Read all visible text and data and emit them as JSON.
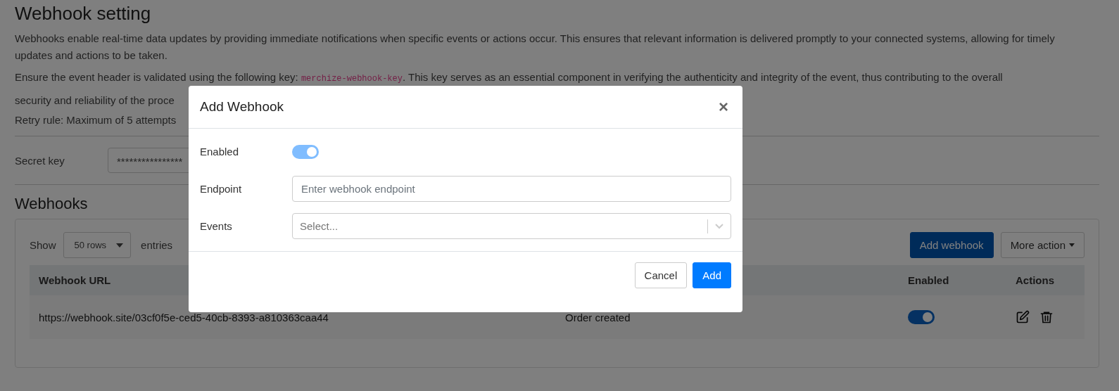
{
  "page": {
    "title": "Webhook setting",
    "intro": "Webhooks enable real-time data updates by providing immediate notifications when specific events or actions occur. This ensures that relevant information is delivered promptly to your connected systems, allowing for timely updates and actions to be taken.",
    "key_note": {
      "before": "Ensure the event header is validated using the following key: ",
      "code": "merchize-webhook-key",
      "after": ". This key serves as an essential component in verifying the authenticity and integrity of the event, thus contributing to the overall",
      "continued": "security and reliability of the proce"
    },
    "retry_rule": "Retry rule: Maximum of 5 attempts",
    "secret_key": {
      "label": "Secret key",
      "value": "****************"
    }
  },
  "webhooks": {
    "title": "Webhooks",
    "show_label": "Show",
    "rows_select": "50 rows",
    "entries_label": "entries",
    "buttons": [
      "Add webhook",
      "More action"
    ],
    "table": {
      "columns": [
        "Webhook URL",
        "Enabled",
        "Actions"
      ],
      "rows": [
        {
          "url": "https://webhook.site/03cf0f5e-ced5-40cb-8393-a810363caa44",
          "events": "Order created",
          "enabled": true
        }
      ]
    }
  },
  "modal": {
    "title": "Add Webhook",
    "close": "×",
    "enabled": {
      "label": "Enabled",
      "on": true
    },
    "endpoint": {
      "label": "Endpoint",
      "placeholder": "Enter webhook endpoint"
    },
    "events": {
      "label": "Events",
      "placeholder": "Select..."
    },
    "buttons": [
      {
        "label": "Cancel",
        "kind": "secondary"
      },
      {
        "label": "Add",
        "kind": "primary"
      }
    ]
  }
}
